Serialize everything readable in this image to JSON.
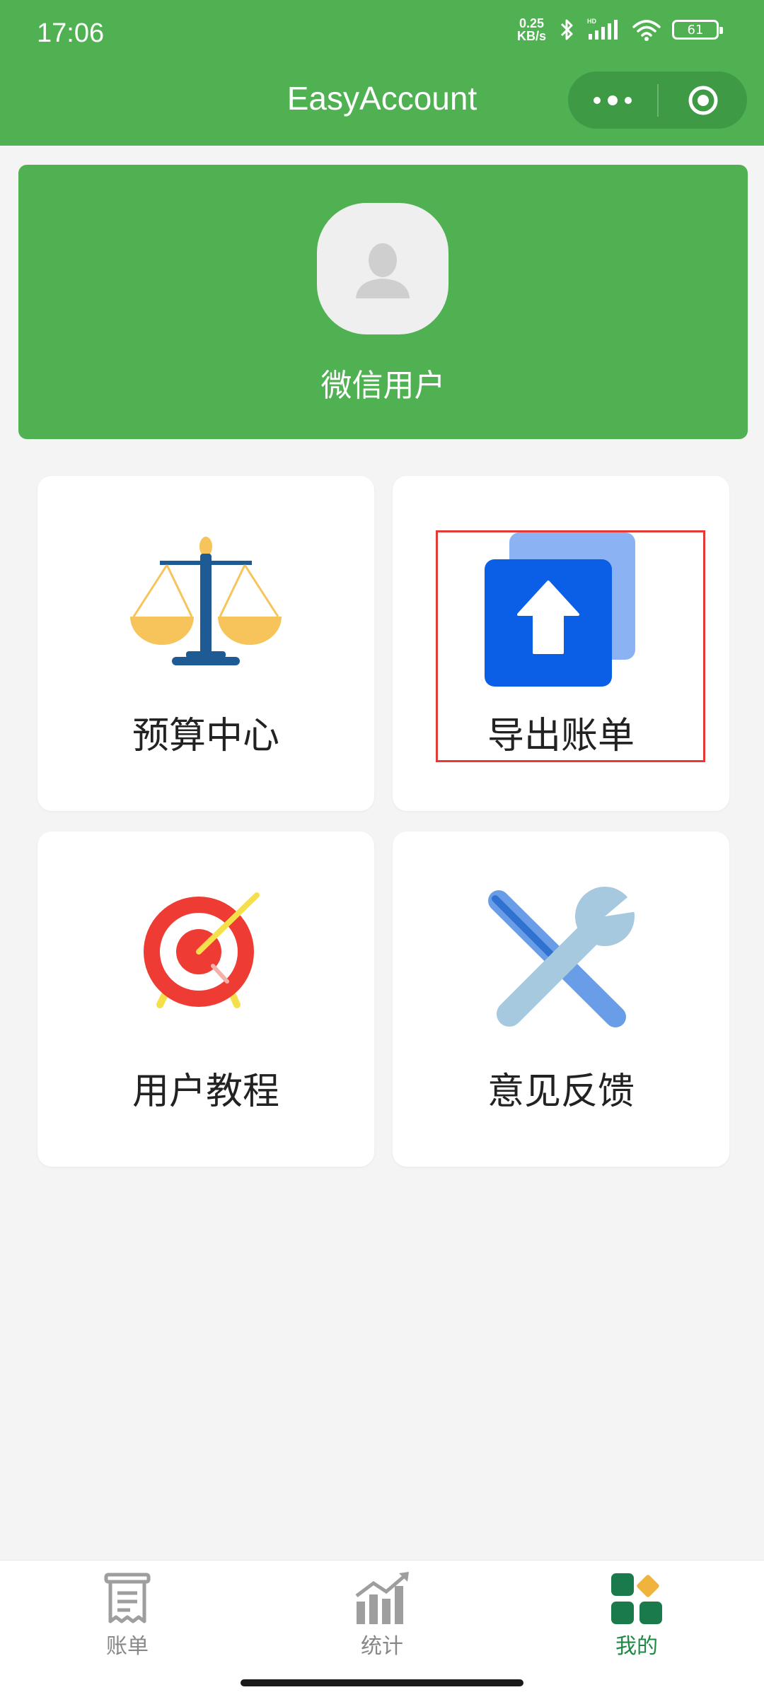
{
  "status_bar": {
    "time": "17:06",
    "net_speed_value": "0.25",
    "net_speed_unit": "KB/s",
    "battery": "61"
  },
  "header": {
    "title": "EasyAccount"
  },
  "profile": {
    "username": "微信用户"
  },
  "menu": {
    "items": [
      {
        "label": "预算中心",
        "icon": "balance-scale-icon"
      },
      {
        "label": "导出账单",
        "icon": "export-upload-icon"
      },
      {
        "label": "用户教程",
        "icon": "target-icon"
      },
      {
        "label": "意见反馈",
        "icon": "tools-icon"
      }
    ]
  },
  "tabbar": {
    "tabs": [
      {
        "label": "账单",
        "icon": "receipt-icon"
      },
      {
        "label": "统计",
        "icon": "chart-icon"
      },
      {
        "label": "我的",
        "icon": "grid-icon"
      }
    ],
    "active_color": "#1f8a46"
  },
  "colors": {
    "brand_green": "#50b153",
    "highlight_red": "#e53935"
  }
}
